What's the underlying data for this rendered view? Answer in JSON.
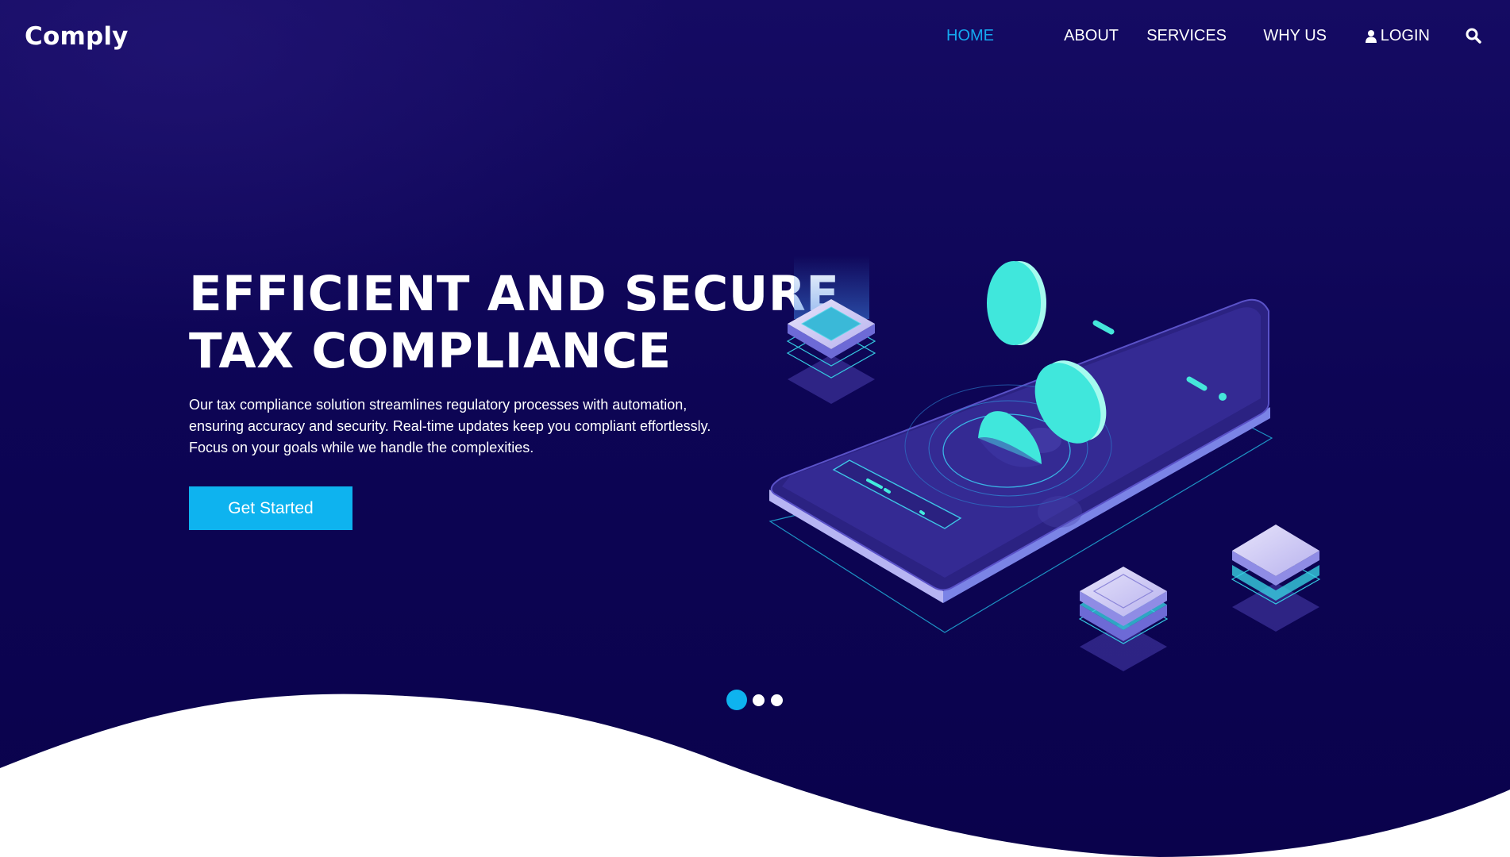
{
  "header": {
    "brand": "Comply",
    "nav": [
      {
        "label": "HOME",
        "active": true
      },
      {
        "label": "ABOUT",
        "active": false
      },
      {
        "label": "SERVICES",
        "active": false
      },
      {
        "label": "WHY US",
        "active": false
      },
      {
        "label": "LOGIN",
        "icon": "user-icon",
        "active": false
      }
    ],
    "search_icon": "search-icon"
  },
  "hero": {
    "headline_lines": [
      "EFFICIENT AND SECURE",
      "TAX COMPLIANCE"
    ],
    "description_lines": [
      "Our tax compliance solution streamlines regulatory processes with automation,",
      "ensuring accuracy and security. Real-time updates keep you compliant effortlessly.",
      "Focus on your goals while we handle the complexities."
    ],
    "cta_label": "Get Started",
    "slider": {
      "total": 3,
      "active": 1
    }
  },
  "colors": {
    "background": "#0b0350",
    "accent": "#0eb3ef",
    "active_nav": "#14a9f0",
    "teal": "#3ee8dc"
  }
}
